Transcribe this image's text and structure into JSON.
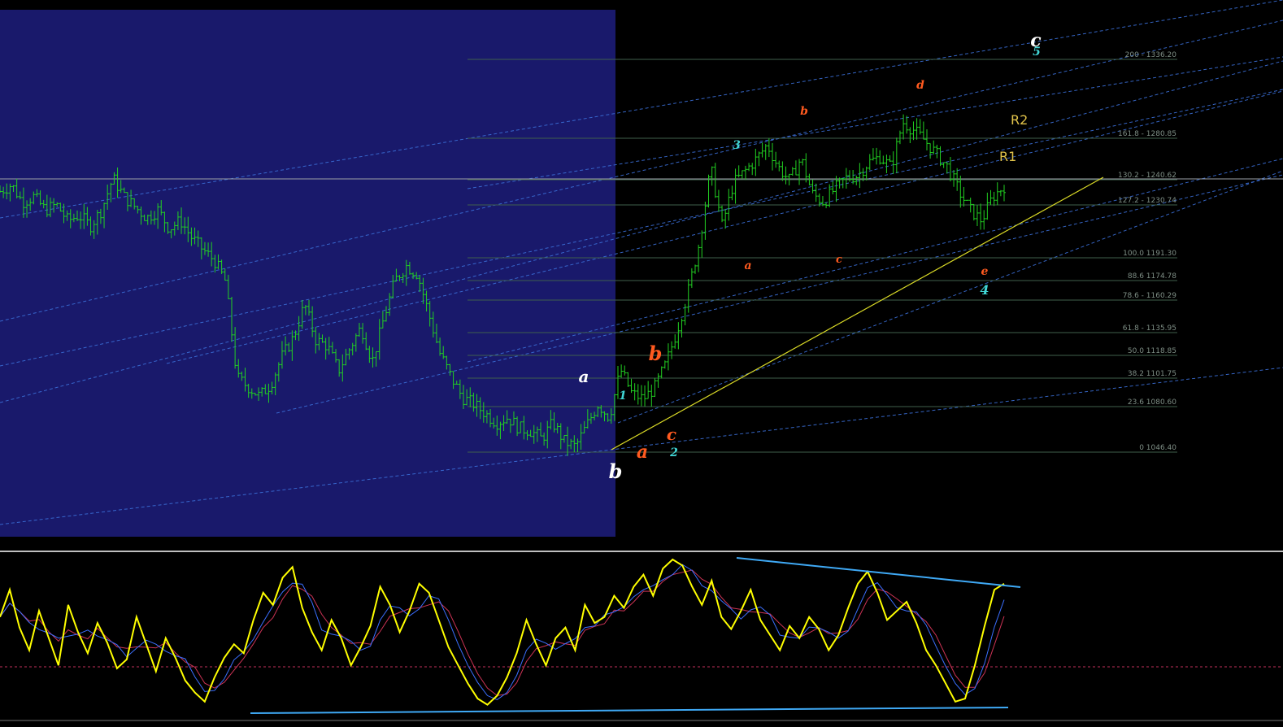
{
  "colors": {
    "background": "#000000",
    "shaded_zone": "#19196b",
    "candles": "#22d122",
    "fib_lines": "#3f5f4d",
    "fib_text": "#7f8f86",
    "channel_lines": "#3b6fd8",
    "trendline": "#d9d926",
    "pivot_text": "#e0c24a",
    "osc_main": "#ffff00",
    "osc_signal_1": "#3b6fff",
    "osc_signal_2": "#cc3355",
    "osc_divergence": "#3fa9f5",
    "osc_midline": "#c0305a",
    "wave_white": "#ffffff",
    "wave_orange": "#ff5a1f",
    "wave_cyan": "#41d6d6"
  },
  "fib_levels": [
    {
      "level_text": "200 - 1336.20",
      "price": 1336.2
    },
    {
      "level_text": "161.8 - 1280.85",
      "price": 1280.85
    },
    {
      "level_text": "130.2 - 1240.62",
      "price": 1240.62
    },
    {
      "level_text": "127.2 - 1230.74",
      "price": 1230.74
    },
    {
      "level_text": "100.0 1191.30",
      "price": 1191.3
    },
    {
      "level_text": "88.6 1174.78",
      "price": 1174.78
    },
    {
      "level_text": "78.6 - 1160.29",
      "price": 1160.29
    },
    {
      "level_text": "61.8 - 1135.95",
      "price": 1135.95
    },
    {
      "level_text": "50.0 1118.85",
      "price": 1118.85
    },
    {
      "level_text": "38.2 1101.75",
      "price": 1101.75
    },
    {
      "level_text": "23.6 1080.60",
      "price": 1080.6
    },
    {
      "level_text": "0 1046.40",
      "price": 1046.4
    }
  ],
  "pivots": [
    {
      "label": "R2"
    },
    {
      "label": "R1"
    }
  ],
  "wave_labels": [
    {
      "text": "a",
      "color": "wave_white"
    },
    {
      "text": "b",
      "color": "wave_white"
    },
    {
      "text": "c",
      "color": "wave_white"
    },
    {
      "text": "5",
      "color": "wave_cyan"
    },
    {
      "text": "1",
      "color": "wave_cyan"
    },
    {
      "text": "2",
      "color": "wave_cyan"
    },
    {
      "text": "3",
      "color": "wave_cyan"
    },
    {
      "text": "4",
      "color": "wave_cyan"
    },
    {
      "text": "b",
      "color": "wave_orange"
    },
    {
      "text": "a",
      "color": "wave_orange"
    },
    {
      "text": "c",
      "color": "wave_orange"
    },
    {
      "text": "a",
      "color": "wave_orange"
    },
    {
      "text": "b",
      "color": "wave_orange"
    },
    {
      "text": "c",
      "color": "wave_orange"
    },
    {
      "text": "d",
      "color": "wave_orange"
    },
    {
      "text": "e",
      "color": "wave_orange"
    }
  ],
  "chart_data": [
    {
      "type": "bar",
      "subtype": "ohlc-price",
      "title": "",
      "ylim": [
        1000,
        1360
      ],
      "close_path": [
        1240,
        1245,
        1232,
        1236,
        1226,
        1230,
        1218,
        1222,
        1214,
        1226,
        1250,
        1236,
        1228,
        1220,
        1226,
        1212,
        1218,
        1205,
        1196,
        1188,
        1172,
        1100,
        1093,
        1086,
        1095,
        1116,
        1130,
        1155,
        1128,
        1124,
        1105,
        1122,
        1138,
        1112,
        1144,
        1173,
        1184,
        1178,
        1148,
        1118,
        1100,
        1085,
        1080,
        1073,
        1066,
        1070,
        1062,
        1060,
        1054,
        1066,
        1052,
        1048,
        1064,
        1080,
        1070,
        1106,
        1088,
        1084,
        1092,
        1110,
        1135,
        1165,
        1202,
        1258,
        1214,
        1246,
        1255,
        1264,
        1275,
        1258,
        1248,
        1265,
        1238,
        1232,
        1242,
        1250,
        1252,
        1262,
        1266,
        1258,
        1292,
        1286,
        1278,
        1268,
        1258,
        1240,
        1226,
        1218,
        1236,
        1244
      ],
      "series": [
        {
          "name": "",
          "role": "close",
          "values": "close_path"
        }
      ]
    },
    {
      "type": "line",
      "subtype": "oscillator",
      "ylim": [
        0,
        100
      ],
      "midline": 50,
      "series": [
        {
          "name": "",
          "color": "osc_main",
          "values": [
            62,
            80,
            55,
            40,
            66,
            48,
            30,
            70,
            52,
            38,
            58,
            45,
            28,
            34,
            62,
            44,
            26,
            48,
            35,
            20,
            12,
            6,
            22,
            35,
            44,
            38,
            60,
            78,
            70,
            88,
            95,
            68,
            52,
            40,
            60,
            48,
            30,
            42,
            56,
            82,
            70,
            52,
            66,
            84,
            78,
            60,
            42,
            30,
            18,
            8,
            4,
            10,
            22,
            38,
            60,
            44,
            30,
            48,
            55,
            40,
            70,
            58,
            62,
            76,
            68,
            82,
            90,
            76,
            94,
            100,
            96,
            82,
            70,
            86,
            62,
            54,
            66,
            80,
            60,
            50,
            40,
            56,
            48,
            62,
            54,
            40,
            50,
            68,
            84,
            92,
            78,
            60,
            66,
            72,
            58,
            40,
            30,
            18,
            6,
            8,
            30,
            56,
            80,
            84
          ]
        }
      ],
      "divergence_lines": 2
    }
  ]
}
